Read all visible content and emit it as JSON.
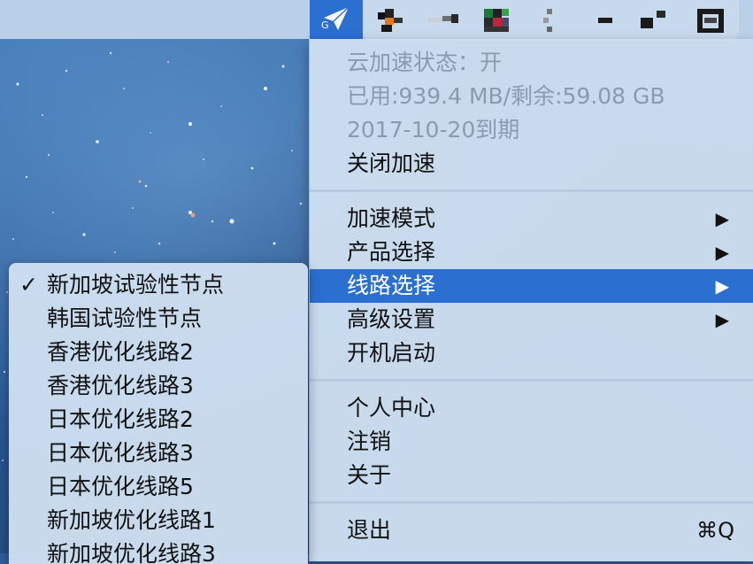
{
  "menubar": {
    "app_icon": "paper-plane-icon",
    "app_icon_badge": "G",
    "tray_icons": [
      "pixelated-icon-1",
      "pixelated-icon-2",
      "pixelated-icon-3",
      "pixelated-icon-4",
      "pixelated-icon-5",
      "pixelated-icon-6",
      "pixelated-icon-7"
    ],
    "accent_color": "#2b6fd1"
  },
  "main_menu": {
    "status_items": [
      {
        "label": "云加速状态：开"
      },
      {
        "label": "已用:939.4 MB/剩余:59.08 GB"
      },
      {
        "label": "2017-10-20到期"
      }
    ],
    "close_accel": "关闭加速",
    "accel_mode": "加速模式",
    "product_select": "产品选择",
    "route_select": "线路选择",
    "advanced_settings": "高级设置",
    "startup": "开机启动",
    "profile": "个人中心",
    "logout": "注销",
    "about": "关于",
    "quit": "退出",
    "quit_shortcut": "⌘Q",
    "submenu_arrow": "▶"
  },
  "route_submenu": {
    "checkmark": "✓",
    "items": [
      {
        "label": "新加坡试验性节点",
        "checked": true
      },
      {
        "label": "韩国试验性节点",
        "checked": false
      },
      {
        "label": "香港优化线路2",
        "checked": false
      },
      {
        "label": "香港优化线路3",
        "checked": false
      },
      {
        "label": "日本优化线路2",
        "checked": false
      },
      {
        "label": "日本优化线路3",
        "checked": false
      },
      {
        "label": "日本优化线路5",
        "checked": false
      },
      {
        "label": "新加坡优化线路1",
        "checked": false
      },
      {
        "label": "新加坡优化线路3",
        "checked": false
      }
    ]
  }
}
